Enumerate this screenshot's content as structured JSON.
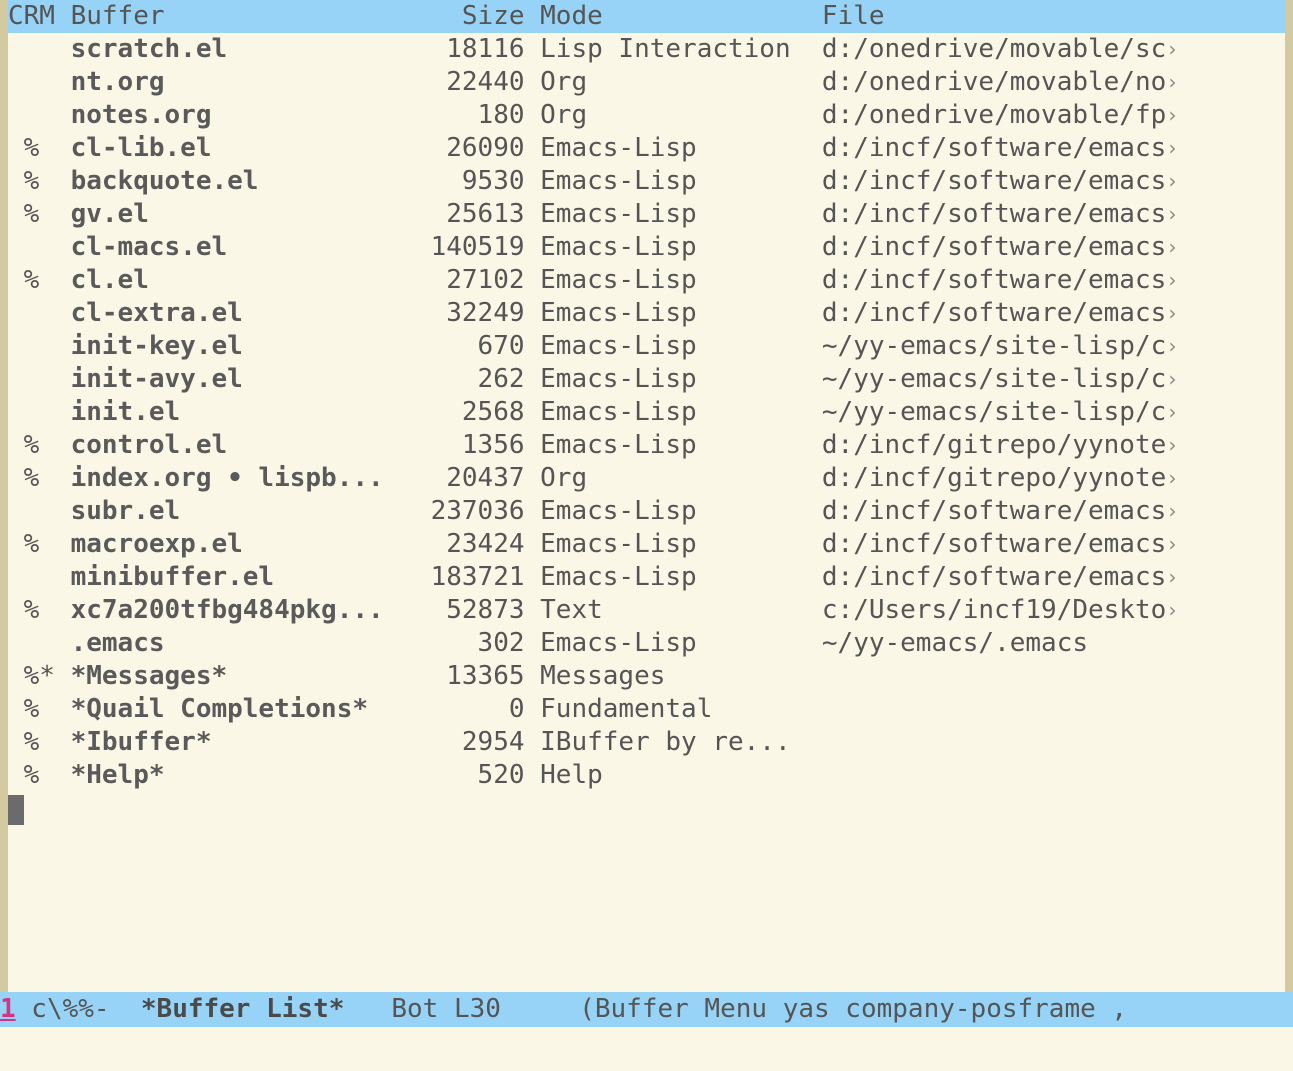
{
  "header": {
    "crm": "CRM",
    "buffer": "Buffer",
    "size": "Size",
    "mode": "Mode",
    "file": "File"
  },
  "rows": [
    {
      "crm": "   ",
      "buffer": "scratch.el",
      "size": "18116",
      "mode": "Lisp Interaction",
      "file": "d:/onedrive/movable/sc",
      "trunc": true
    },
    {
      "crm": "   ",
      "buffer": "nt.org",
      "size": "22440",
      "mode": "Org",
      "file": "d:/onedrive/movable/no",
      "trunc": true
    },
    {
      "crm": "   ",
      "buffer": "notes.org",
      "size": "180",
      "mode": "Org",
      "file": "d:/onedrive/movable/fp",
      "trunc": true
    },
    {
      "crm": " % ",
      "buffer": "cl-lib.el",
      "size": "26090",
      "mode": "Emacs-Lisp",
      "file": "d:/incf/software/emacs",
      "trunc": true
    },
    {
      "crm": " % ",
      "buffer": "backquote.el",
      "size": "9530",
      "mode": "Emacs-Lisp",
      "file": "d:/incf/software/emacs",
      "trunc": true
    },
    {
      "crm": " % ",
      "buffer": "gv.el",
      "size": "25613",
      "mode": "Emacs-Lisp",
      "file": "d:/incf/software/emacs",
      "trunc": true
    },
    {
      "crm": "   ",
      "buffer": "cl-macs.el",
      "size": "140519",
      "mode": "Emacs-Lisp",
      "file": "d:/incf/software/emacs",
      "trunc": true
    },
    {
      "crm": " % ",
      "buffer": "cl.el",
      "size": "27102",
      "mode": "Emacs-Lisp",
      "file": "d:/incf/software/emacs",
      "trunc": true
    },
    {
      "crm": "   ",
      "buffer": "cl-extra.el",
      "size": "32249",
      "mode": "Emacs-Lisp",
      "file": "d:/incf/software/emacs",
      "trunc": true
    },
    {
      "crm": "   ",
      "buffer": "init-key.el",
      "size": "670",
      "mode": "Emacs-Lisp",
      "file": "~/yy-emacs/site-lisp/c",
      "trunc": true
    },
    {
      "crm": "   ",
      "buffer": "init-avy.el",
      "size": "262",
      "mode": "Emacs-Lisp",
      "file": "~/yy-emacs/site-lisp/c",
      "trunc": true
    },
    {
      "crm": "   ",
      "buffer": "init.el",
      "size": "2568",
      "mode": "Emacs-Lisp",
      "file": "~/yy-emacs/site-lisp/c",
      "trunc": true
    },
    {
      "crm": " % ",
      "buffer": "control.el",
      "size": "1356",
      "mode": "Emacs-Lisp",
      "file": "d:/incf/gitrepo/yynote",
      "trunc": true
    },
    {
      "crm": " % ",
      "buffer": "index.org • lispb...",
      "size": "20437",
      "mode": "Org",
      "file": "d:/incf/gitrepo/yynote",
      "trunc": true
    },
    {
      "crm": "   ",
      "buffer": "subr.el",
      "size": "237036",
      "mode": "Emacs-Lisp",
      "file": "d:/incf/software/emacs",
      "trunc": true
    },
    {
      "crm": " % ",
      "buffer": "macroexp.el",
      "size": "23424",
      "mode": "Emacs-Lisp",
      "file": "d:/incf/software/emacs",
      "trunc": true
    },
    {
      "crm": "   ",
      "buffer": "minibuffer.el",
      "size": "183721",
      "mode": "Emacs-Lisp",
      "file": "d:/incf/software/emacs",
      "trunc": true
    },
    {
      "crm": " % ",
      "buffer": "xc7a200tfbg484pkg...",
      "size": "52873",
      "mode": "Text",
      "file": "c:/Users/incf19/Deskto",
      "trunc": true
    },
    {
      "crm": "   ",
      "buffer": ".emacs",
      "size": "302",
      "mode": "Emacs-Lisp",
      "file": "~/yy-emacs/.emacs",
      "trunc": false
    },
    {
      "crm": " %*",
      "buffer": "*Messages*",
      "size": "13365",
      "mode": "Messages",
      "file": "",
      "trunc": false
    },
    {
      "crm": " % ",
      "buffer": "*Quail Completions*",
      "size": "0",
      "mode": "Fundamental",
      "file": "",
      "trunc": false
    },
    {
      "crm": " % ",
      "buffer": "*Ibuffer*",
      "size": "2954",
      "mode": "IBuffer by re...",
      "file": "",
      "trunc": false
    },
    {
      "crm": " % ",
      "buffer": "*Help*",
      "size": "520",
      "mode": "Help",
      "file": "",
      "trunc": false
    }
  ],
  "mode_line": {
    "win_number": "1",
    "status": " c\\%%-  ",
    "buffer_name": "*Buffer List*",
    "position": "   Bot L30     ",
    "modes": "(Buffer Menu yas company-posframe ,"
  }
}
